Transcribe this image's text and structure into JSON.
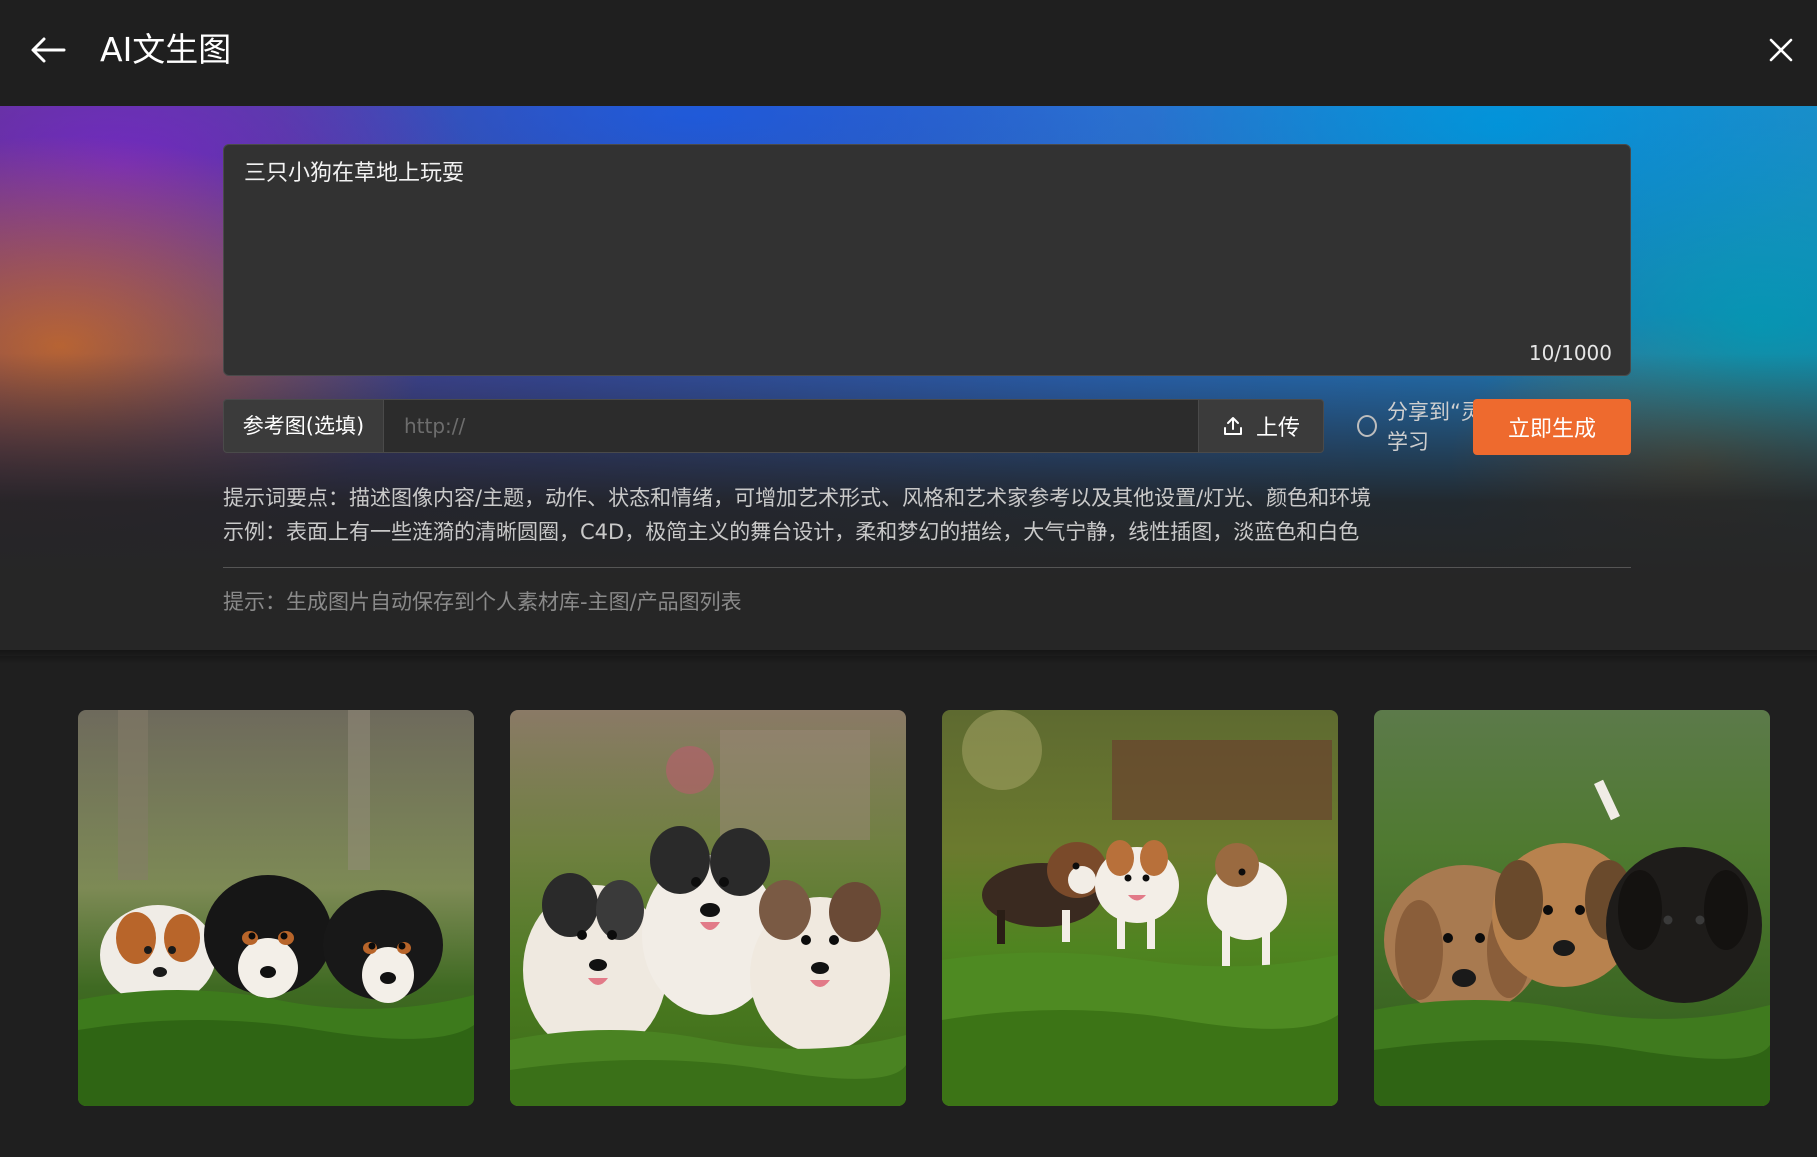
{
  "header": {
    "title": "AI文生图"
  },
  "prompt": {
    "text": "三只小狗在草地上玩耍",
    "counter": "10/1000"
  },
  "reference": {
    "label": "参考图(选填)",
    "placeholder": "http://",
    "upload_label": "上传"
  },
  "share": {
    "label": "分享到“灵感集市”，相互学习",
    "checked": false
  },
  "generate": {
    "label": "立即生成"
  },
  "tips": {
    "line1": "提示词要点：描述图像内容/主题，动作、状态和情绪，可增加艺术形式、风格和艺术家参考以及其他设置/灯光、颜色和环境",
    "line2": "示例：表面上有一些涟漪的清晰圆圈，C4D，极简主义的舞台设计，柔和梦幻的描绘，大气宁静，线性插图，淡蓝色和白色"
  },
  "save_hint": "提示：生成图片自动保存到个人素材库-主图/产品图列表",
  "colors": {
    "accent": "#ee6a2e",
    "background": "#1f1f1f",
    "panel": "#323232"
  },
  "gallery": [
    {
      "subject": "three-puppies-lying-on-grass"
    },
    {
      "subject": "three-fluffy-puppies-sitting-on-grass"
    },
    {
      "subject": "three-puppies-running-on-lawn"
    },
    {
      "subject": "three-puppies-lying-close-up"
    }
  ]
}
